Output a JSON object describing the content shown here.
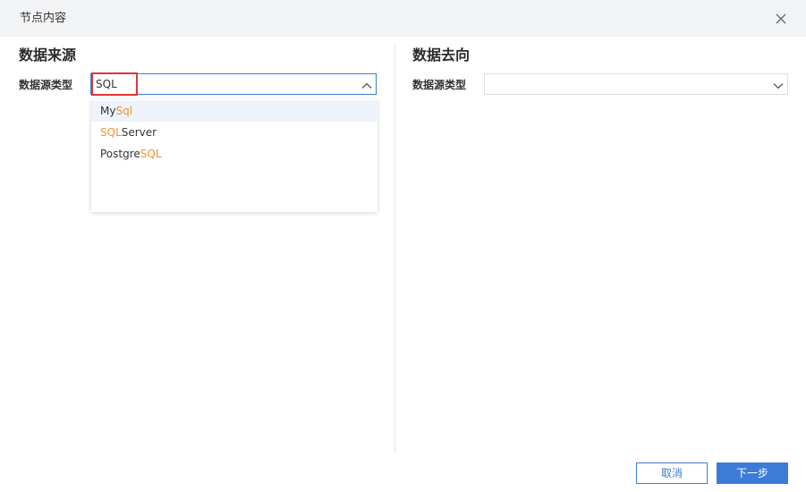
{
  "dialog": {
    "title": "节点内容",
    "close_icon": "close-icon"
  },
  "source": {
    "title": "数据来源",
    "type_label": "数据源类型",
    "search_value": "SQL",
    "caret_icon": "chevron-up-icon",
    "options": [
      {
        "prefix": "My",
        "match": "Sql",
        "suffix": ""
      },
      {
        "prefix": "",
        "match": "SQL",
        "suffix": "Server"
      },
      {
        "prefix": "Postgre",
        "match": "SQL",
        "suffix": ""
      }
    ]
  },
  "target": {
    "title": "数据去向",
    "type_label": "数据源类型",
    "value": "",
    "caret_icon": "chevron-down-icon"
  },
  "footer": {
    "cancel_label": "取消",
    "next_label": "下一步"
  },
  "colors": {
    "accent": "#3d7bd8",
    "match_highlight": "#f0922c",
    "search_outline": "#e0353a",
    "header_bg": "#f2f3f5"
  }
}
